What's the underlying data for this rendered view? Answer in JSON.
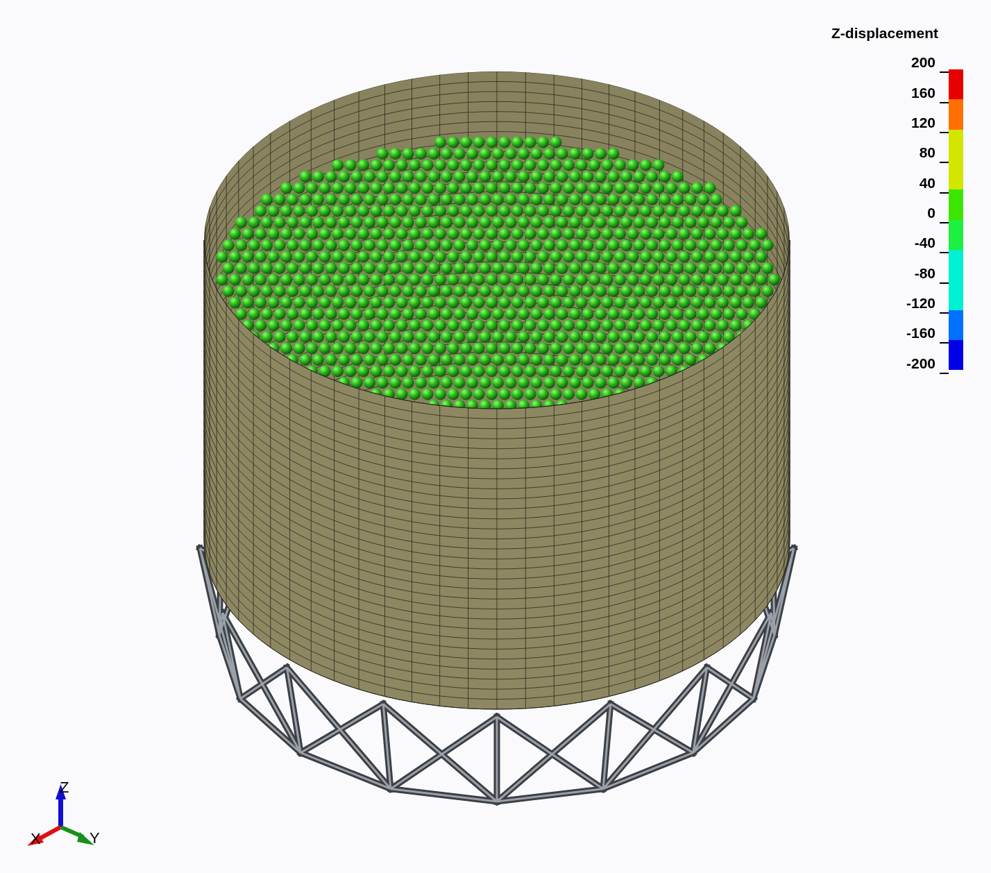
{
  "legend": {
    "title": "Z-displacement",
    "labels": [
      "200",
      "160",
      "120",
      "80",
      "40",
      "0",
      "-40",
      "-80",
      "-120",
      "-160",
      "-200"
    ],
    "bands": [
      {
        "color": "#e60000"
      },
      {
        "color": "#ff7000"
      },
      {
        "color": "#d2e600"
      },
      {
        "color": "#d2e600"
      },
      {
        "color": "#3ce600"
      },
      {
        "color": "#1cf040"
      },
      {
        "color": "#00f0d2"
      },
      {
        "color": "#00f0d2"
      },
      {
        "color": "#0070ff"
      },
      {
        "color": "#0000e6"
      }
    ]
  },
  "axis_triad": {
    "x": "X",
    "y": "Y",
    "z": "Z"
  }
}
